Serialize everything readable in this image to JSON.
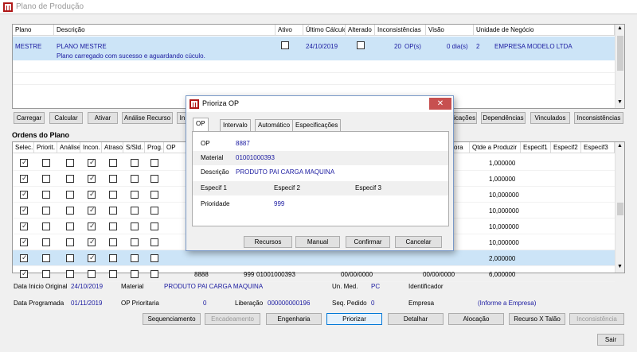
{
  "window": {
    "title": "Plano de Produção"
  },
  "plan_grid": {
    "headers": [
      "Plano",
      "Descrição",
      "Ativo",
      "Último Cálculo",
      "Alterado",
      "Inconsistências",
      "Visão",
      "Unidade de Negócio"
    ],
    "row": {
      "plano": "MESTRE",
      "descricao": "PLANO MESTRE",
      "descricao_sub": "Plano carregado com sucesso e aguardando cúculo.",
      "ativo": false,
      "ultimo_calculo": "24/10/2019",
      "alterado": false,
      "inconsistencias": "20",
      "op_label": "OP(s)",
      "visao": "0 dia(s)",
      "unidade_codigo": "2",
      "unidade_nome": "EMPRESA MODELO LTDA"
    }
  },
  "plan_buttons": {
    "carregar": "Carregar",
    "calcular": "Calcular",
    "ativar": "Ativar",
    "analise_recurso": "Análise Recurso",
    "partial_in": "In",
    "aplicacoes": "icações",
    "dependencias": "Dependências",
    "vinculados": "Vinculados",
    "inconsistencias": "Inconsistências"
  },
  "orders": {
    "section_title": "Ordens do Plano",
    "headers": {
      "selec": "Selec.",
      "priorit": "Priorit.",
      "analise": "Análise",
      "incon": "Incon.",
      "atraso": "Atraso",
      "ssld": "S/Sld.",
      "prog": "Prog.",
      "op": "OP",
      "hora": "ora",
      "qtde": "Qtde a Produzir",
      "especif1": "Especif1",
      "especif2": "Especif2",
      "especif3": "Especif3"
    },
    "rows": [
      {
        "selec": true,
        "priorit": false,
        "analise": false,
        "incon": true,
        "atraso": false,
        "ssld": false,
        "prog": false,
        "qtde": "1,000000",
        "selected": false
      },
      {
        "selec": true,
        "priorit": false,
        "analise": false,
        "incon": true,
        "atraso": false,
        "ssld": false,
        "prog": false,
        "qtde": "1,000000",
        "selected": false
      },
      {
        "selec": true,
        "priorit": false,
        "analise": false,
        "incon": true,
        "atraso": false,
        "ssld": false,
        "prog": false,
        "qtde": "10,000000",
        "selected": false
      },
      {
        "selec": true,
        "priorit": false,
        "analise": false,
        "incon": true,
        "atraso": false,
        "ssld": false,
        "prog": false,
        "qtde": "10,000000",
        "selected": false
      },
      {
        "selec": true,
        "priorit": false,
        "analise": false,
        "incon": true,
        "atraso": false,
        "ssld": false,
        "prog": false,
        "qtde": "10,000000",
        "selected": false
      },
      {
        "selec": true,
        "priorit": false,
        "analise": false,
        "incon": true,
        "atraso": false,
        "ssld": false,
        "prog": false,
        "qtde": "10,000000",
        "selected": false
      },
      {
        "selec": true,
        "priorit": false,
        "analise": false,
        "incon": true,
        "atraso": false,
        "ssld": false,
        "prog": false,
        "qtde": "2,000000",
        "selected": true
      },
      {
        "selec": true,
        "priorit": false,
        "analise": false,
        "incon": false,
        "atraso": false,
        "ssld": false,
        "prog": false,
        "op": "8888",
        "prioridade": "999",
        "material": "01001000393",
        "date1": "00/00/0000",
        "date2": "00/00/0000",
        "qtde": "6,000000",
        "selected": false
      }
    ]
  },
  "details": {
    "data_inicio_label": "Data Inicio Original",
    "data_inicio": "24/10/2019",
    "material_label": "Material",
    "material": "PRODUTO PAI CARGA MAQUINA",
    "un_med_label": "Un. Med.",
    "un_med": "PC",
    "identificador_label": "Identificador",
    "data_prog_label": "Data Programada",
    "data_prog": "01/11/2019",
    "op_prior_label": "OP Prioritaria",
    "op_prior": "0",
    "liberacao_label": "Liberação",
    "liberacao": "000000000196",
    "seq_pedido_label": "Seq. Pedido",
    "seq_pedido": "0",
    "empresa_label": "Empresa",
    "empresa": "(Informe a Empresa)"
  },
  "bottom_buttons": {
    "sequenciamento": "Sequenciamento",
    "encadeamento": "Encadeamento",
    "engenharia": "Engenharia",
    "priorizar": "Priorizar",
    "detalhar": "Detalhar",
    "alocacao": "Alocação",
    "recurso_talao": "Recurso X Talão",
    "inconsistencia": "Inconsistência",
    "sair": "Sair"
  },
  "dialog": {
    "title": "Prioriza OP",
    "close": "✕",
    "tabs": [
      "OP",
      "Intervalo",
      "Automático",
      "Especificações"
    ],
    "op_label": "OP",
    "op": "8887",
    "material_label": "Material",
    "material": "01001000393",
    "descricao_label": "Descrição",
    "descricao": "PRODUTO PAI CARGA MAQUINA",
    "especif1": "Especif 1",
    "especif2": "Especif 2",
    "especif3": "Especif 3",
    "prioridade_label": "Prioridade",
    "prioridade": "999",
    "buttons": {
      "recursos": "Recursos",
      "manual": "Manual",
      "confirmar": "Confirmar",
      "cancelar": "Cancelar"
    }
  },
  "colors": {
    "selected_row": "#cce4f7",
    "value_blue": "#1a1aa0",
    "close_red": "#c75050"
  }
}
